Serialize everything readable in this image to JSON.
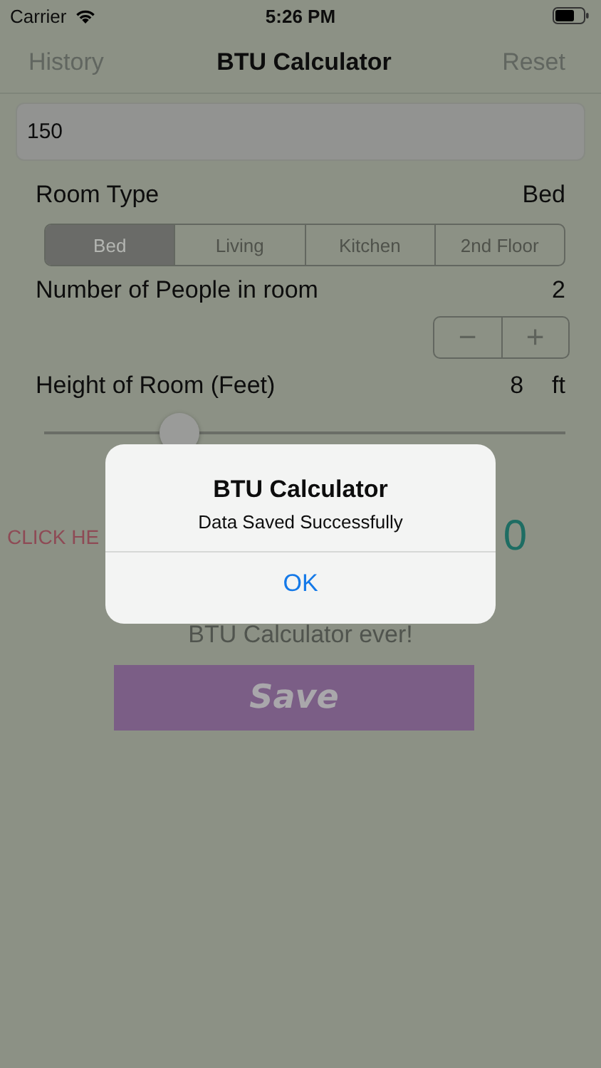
{
  "status_bar": {
    "carrier": "Carrier",
    "time": "5:26 PM"
  },
  "nav": {
    "left": "History",
    "title": "BTU Calculator",
    "right": "Reset"
  },
  "area_field": {
    "value": "150"
  },
  "room_type": {
    "label": "Room Type",
    "value": "Bed"
  },
  "segments": [
    {
      "label": "Bed",
      "selected": true
    },
    {
      "label": "Living",
      "selected": false
    },
    {
      "label": "Kitchen",
      "selected": false
    },
    {
      "label": "2nd Floor",
      "selected": false
    }
  ],
  "people": {
    "label": "Number of People in room",
    "value": "2",
    "minus": "−",
    "plus": "+"
  },
  "height": {
    "label": "Height of Room (Feet)",
    "value": "8",
    "unit": "ft",
    "level": 0.26
  },
  "result": {
    "link": "CLICK HE",
    "value": "0",
    "tagline": "BTU Calculator ever!"
  },
  "save_button": "Save",
  "alert": {
    "title": "BTU Calculator",
    "message": "Data Saved Successfully",
    "button": "OK"
  }
}
